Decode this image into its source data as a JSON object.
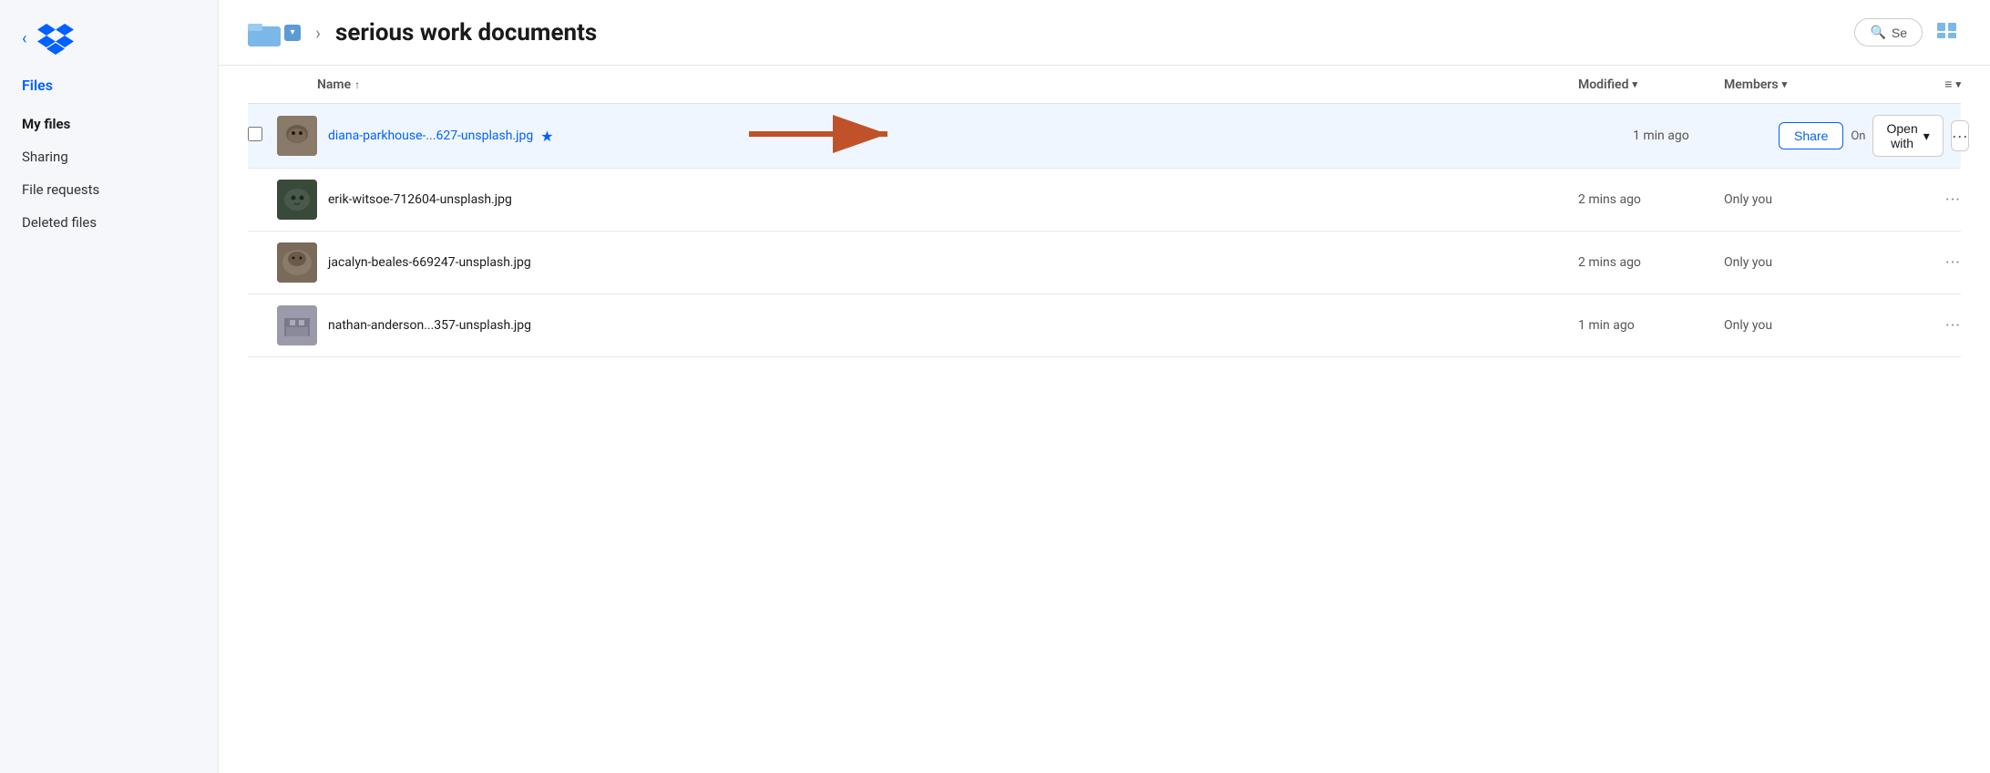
{
  "sidebar": {
    "collapse_label": "‹",
    "section_title": "Files",
    "nav_items": [
      {
        "id": "my-files",
        "label": "My files",
        "active": true
      },
      {
        "id": "sharing",
        "label": "Sharing",
        "active": false
      },
      {
        "id": "file-requests",
        "label": "File requests",
        "active": false
      },
      {
        "id": "deleted-files",
        "label": "Deleted files",
        "active": false
      }
    ]
  },
  "header": {
    "folder_name": "serious work documents",
    "breadcrumb_separator": "›"
  },
  "file_list": {
    "columns": {
      "name": "Name",
      "name_sort_icon": "↑",
      "modified": "Modified",
      "members": "Members",
      "list_view_icon": "≡"
    },
    "files": [
      {
        "id": "file-1",
        "name": "diana-parkhouse-...627-unsplash.jpg",
        "modified": "1 min ago",
        "members": "On",
        "highlighted": true,
        "starred": true,
        "thumb_class": "thumb-cat1"
      },
      {
        "id": "file-2",
        "name": "erik-witsoe-712604-unsplash.jpg",
        "modified": "2 mins ago",
        "members": "Only you",
        "highlighted": false,
        "starred": false,
        "thumb_class": "thumb-cat2"
      },
      {
        "id": "file-3",
        "name": "jacalyn-beales-669247-unsplash.jpg",
        "modified": "2 mins ago",
        "members": "Only you",
        "highlighted": false,
        "starred": false,
        "thumb_class": "thumb-animal"
      },
      {
        "id": "file-4",
        "name": "nathan-anderson...357-unsplash.jpg",
        "modified": "1 min ago",
        "members": "Only you",
        "highlighted": false,
        "starred": false,
        "thumb_class": "thumb-building"
      }
    ],
    "share_button": "Share",
    "open_with_button": "Open with",
    "more_button": "•••"
  },
  "colors": {
    "accent": "#0061ff",
    "arrow_fill": "#c0522a",
    "sidebar_bg": "#f5f7fa"
  }
}
